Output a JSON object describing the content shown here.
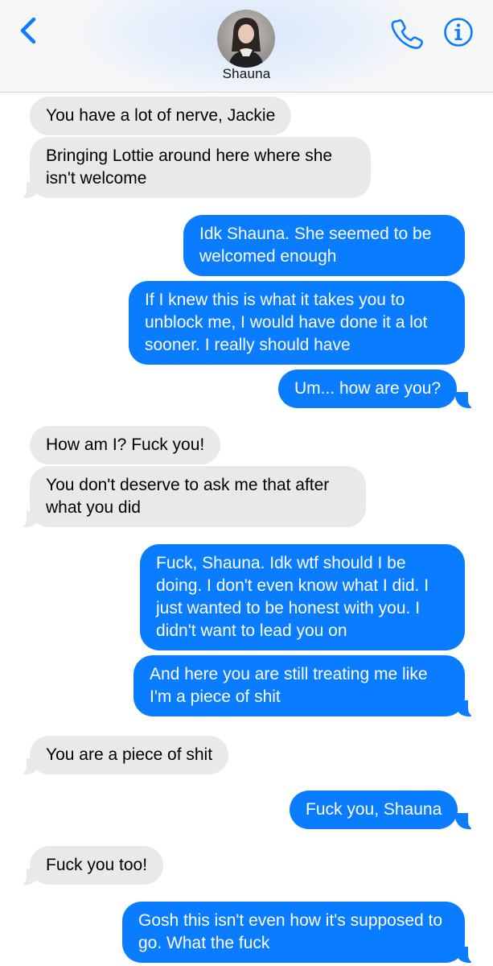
{
  "header": {
    "contact_name": "Shauna",
    "back_icon": "chevron-left-icon",
    "call_icon": "phone-icon",
    "info_icon": "info-icon",
    "accent_color": "#0a7cff"
  },
  "messages": [
    {
      "from": "them",
      "text": "You have a lot of nerve, Jackie"
    },
    {
      "from": "them",
      "text": "Bringing Lottie around here where she isn't welcome"
    },
    {
      "from": "me",
      "text": "Idk Shauna. She seemed to be welcomed enough"
    },
    {
      "from": "me",
      "text": "If I knew this is what it takes you to unblock me, I would have done it a lot sooner. I really should have"
    },
    {
      "from": "me",
      "text": "Um... how are you?"
    },
    {
      "from": "them",
      "text": "How am I? Fuck you!"
    },
    {
      "from": "them",
      "text": "You don't deserve to ask me that after what you did"
    },
    {
      "from": "me",
      "text": "Fuck, Shauna. Idk wtf should I be doing. I don't even know what I did. I just wanted to be honest with you. I didn't want to lead you on"
    },
    {
      "from": "me",
      "text": "And here you are still treating me like I'm a piece of shit"
    },
    {
      "from": "them",
      "text": "You are a piece of shit"
    },
    {
      "from": "me",
      "text": "Fuck you, Shauna"
    },
    {
      "from": "them",
      "text": "Fuck you too!"
    },
    {
      "from": "me",
      "text": "Gosh this isn't even how it's supposed to go. What the fuck"
    }
  ],
  "colors": {
    "incoming_bubble": "#e9e9eb",
    "outgoing_bubble": "#0a7cff"
  }
}
